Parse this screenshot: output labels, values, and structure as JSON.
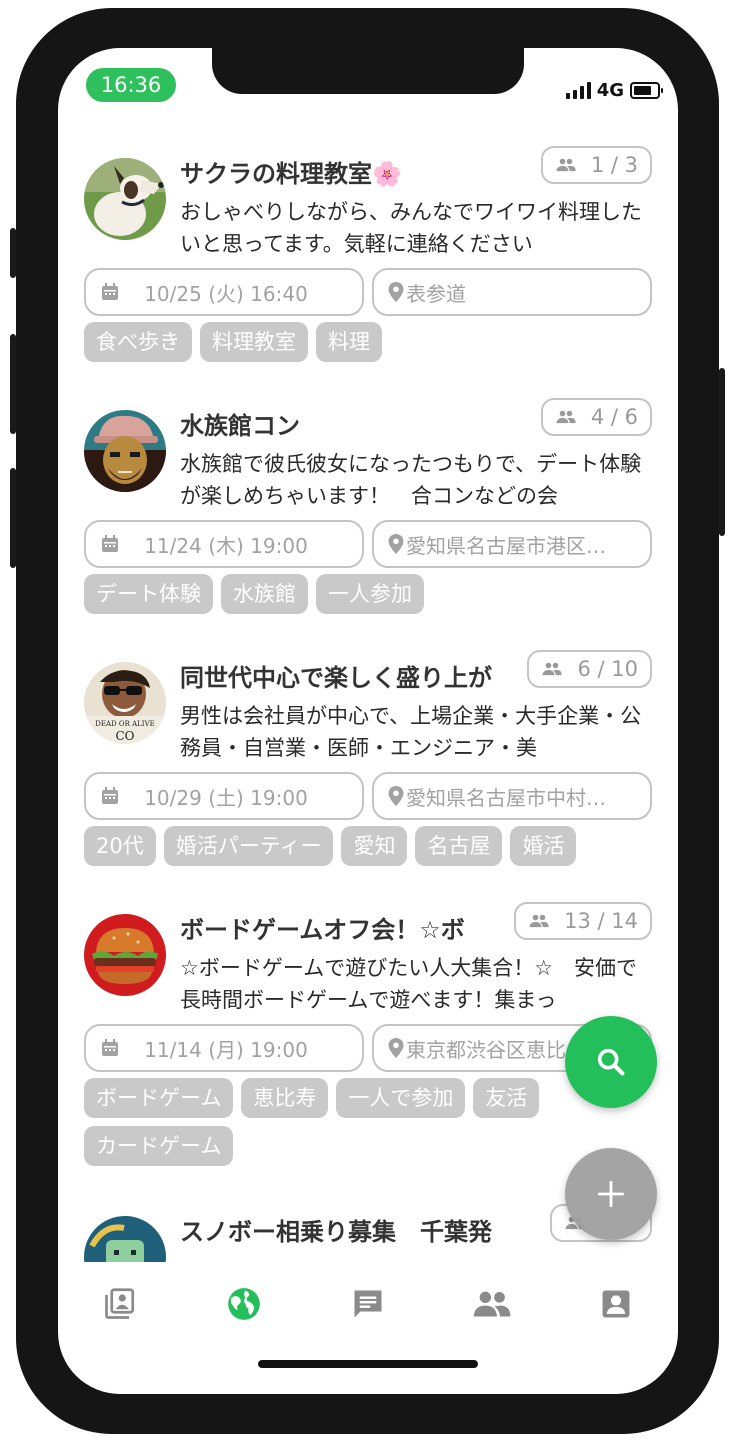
{
  "status_bar": {
    "time": "16:36",
    "network": "4G"
  },
  "events": [
    {
      "title": "サクラの料理教室🌸",
      "count": "1 / 3",
      "description": "おしゃべりしながら、みんなでワイワイ料理したいと思ってます。気軽に連絡ください",
      "date": "10/25 (火) 16:40",
      "location": "表参道",
      "tags": [
        "食べ歩き",
        "料理教室",
        "料理"
      ]
    },
    {
      "title": "水族館コン",
      "count": "4 / 6",
      "description": "水族館で彼氏彼女になったつもりで、デート体験が楽しめちゃいます！　合コンなどの会",
      "date": "11/24 (木) 19:00",
      "location": "愛知県名古屋市港区…",
      "tags": [
        "デート体験",
        "水族館",
        "一人参加"
      ]
    },
    {
      "title": "同世代中心で楽しく盛り上が",
      "count": "6 / 10",
      "description": "男性は会社員が中心で、上場企業・大手企業・公務員・自営業・医師・エンジニア・美",
      "date": "10/29 (土) 19:00",
      "location": "愛知県名古屋市中村…",
      "tags": [
        "20代",
        "婚活パーティー",
        "愛知",
        "名古屋",
        "婚活"
      ],
      "avatar_caption": [
        "DEAD OR ALIVE",
        "CO"
      ]
    },
    {
      "title": "ボードゲームオフ会！☆ボ",
      "count": "13 / 14",
      "description": "☆ボードゲームで遊びたい人大集合！☆　安価で長時間ボードゲームで遊べます！集まっ",
      "date": "11/14 (月) 19:00",
      "location": "東京都渋谷区恵比",
      "tags": [
        "ボードゲーム",
        "恵比寿",
        "一人で参加",
        "友活",
        "カードゲーム"
      ]
    },
    {
      "title": "スノボー相乗り募集　千葉発",
      "count": "",
      "description": "",
      "date": "",
      "location": "",
      "tags": []
    }
  ],
  "tab_bar": {
    "items": [
      {
        "icon": "album-icon",
        "active": false
      },
      {
        "icon": "globe-icon",
        "active": true
      },
      {
        "icon": "chat-icon",
        "active": false
      },
      {
        "icon": "people-icon",
        "active": false
      },
      {
        "icon": "profile-icon",
        "active": false
      }
    ]
  },
  "colors": {
    "accent": "#22bf5b",
    "tag_bg": "#c9c9c9",
    "border": "#c4c4c4",
    "muted_text": "#a2a2a2",
    "inactive_icon": "#8a8a8a"
  }
}
